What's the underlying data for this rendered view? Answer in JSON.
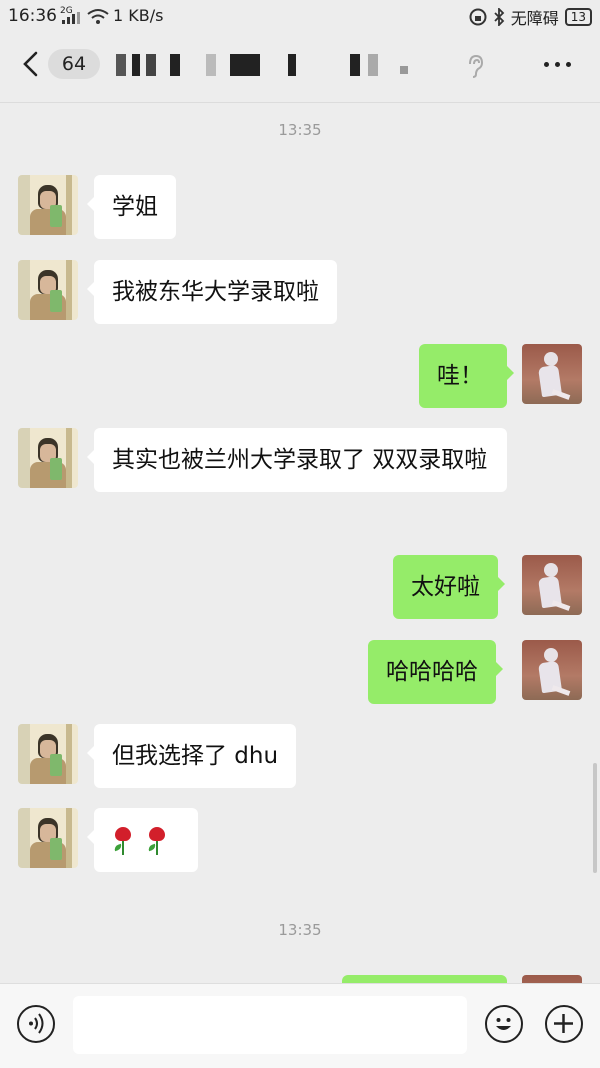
{
  "status_bar": {
    "time": "16:36",
    "signal_label": "2G",
    "net_speed": "1 KB/s",
    "accessibility": "无障碍",
    "battery": "13"
  },
  "header": {
    "unread_count": "64"
  },
  "messages": [
    {
      "type": "time",
      "text": "13:35"
    },
    {
      "type": "in",
      "text": "学姐"
    },
    {
      "type": "in",
      "text": "我被东华大学录取啦"
    },
    {
      "type": "out",
      "text": "哇！"
    },
    {
      "type": "in",
      "text": "其实也被兰州大学录取了 双双录取啦"
    },
    {
      "type": "out",
      "text": "太好啦"
    },
    {
      "type": "out",
      "text": "哈哈哈哈"
    },
    {
      "type": "in",
      "text": "但我选择了 dhu"
    },
    {
      "type": "in",
      "content": "two rose emojis"
    },
    {
      "type": "time",
      "text": "13:35"
    }
  ],
  "colors": {
    "background": "#ededed",
    "outgoing_bubble": "#95ec69",
    "incoming_bubble": "#ffffff"
  },
  "icons": [
    "back-icon",
    "ear-icon",
    "more-icon",
    "voice-icon",
    "emoji-icon",
    "plus-icon",
    "rose-icon"
  ]
}
